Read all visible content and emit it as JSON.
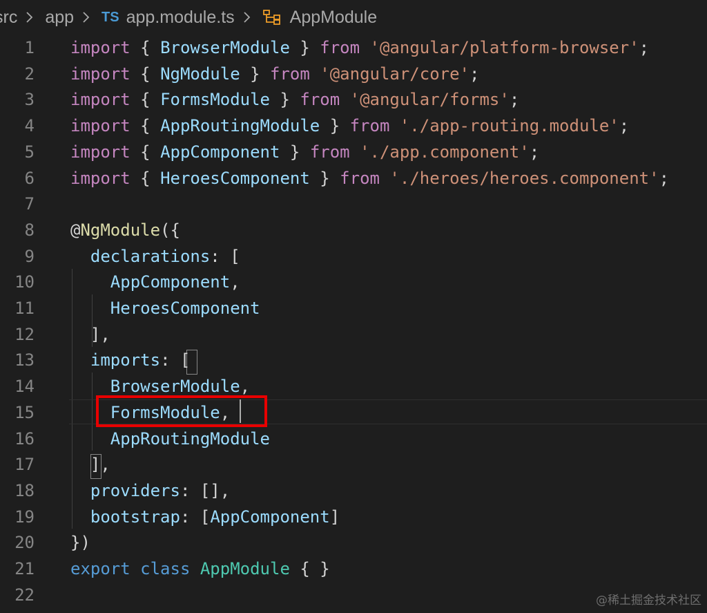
{
  "breadcrumb": {
    "segments": [
      "src",
      "app"
    ],
    "file_icon": "TS",
    "file_name": "app.module.ts",
    "symbol_icon": "symbol-class-icon",
    "symbol": "AppModule"
  },
  "line_numbers": [
    "1",
    "2",
    "3",
    "4",
    "5",
    "6",
    "7",
    "8",
    "9",
    "10",
    "11",
    "12",
    "13",
    "14",
    "15",
    "16",
    "17",
    "18",
    "19",
    "20",
    "21",
    "22"
  ],
  "code_lines": [
    [
      [
        "import",
        "kw"
      ],
      [
        " { ",
        "p"
      ],
      [
        "BrowserModule",
        "id"
      ],
      [
        " } ",
        "p"
      ],
      [
        "from",
        "kw"
      ],
      [
        " ",
        "p"
      ],
      [
        "'@angular/platform-browser'",
        "str"
      ],
      [
        ";",
        "p"
      ]
    ],
    [
      [
        "import",
        "kw"
      ],
      [
        " { ",
        "p"
      ],
      [
        "NgModule",
        "id"
      ],
      [
        " } ",
        "p"
      ],
      [
        "from",
        "kw"
      ],
      [
        " ",
        "p"
      ],
      [
        "'@angular/core'",
        "str"
      ],
      [
        ";",
        "p"
      ]
    ],
    [
      [
        "import",
        "kw"
      ],
      [
        " { ",
        "p"
      ],
      [
        "FormsModule",
        "id"
      ],
      [
        " } ",
        "p"
      ],
      [
        "from",
        "kw"
      ],
      [
        " ",
        "p"
      ],
      [
        "'@angular/forms'",
        "str"
      ],
      [
        ";",
        "p"
      ]
    ],
    [
      [
        "import",
        "kw"
      ],
      [
        " { ",
        "p"
      ],
      [
        "AppRoutingModule",
        "id"
      ],
      [
        " } ",
        "p"
      ],
      [
        "from",
        "kw"
      ],
      [
        " ",
        "p"
      ],
      [
        "'./app-routing.module'",
        "str"
      ],
      [
        ";",
        "p"
      ]
    ],
    [
      [
        "import",
        "kw"
      ],
      [
        " { ",
        "p"
      ],
      [
        "AppComponent",
        "id"
      ],
      [
        " } ",
        "p"
      ],
      [
        "from",
        "kw"
      ],
      [
        " ",
        "p"
      ],
      [
        "'./app.component'",
        "str"
      ],
      [
        ";",
        "p"
      ]
    ],
    [
      [
        "import",
        "kw"
      ],
      [
        " { ",
        "p"
      ],
      [
        "HeroesComponent",
        "id"
      ],
      [
        " } ",
        "p"
      ],
      [
        "from",
        "kw"
      ],
      [
        " ",
        "p"
      ],
      [
        "'./heroes/heroes.component'",
        "str"
      ],
      [
        ";",
        "p"
      ]
    ],
    [],
    [
      [
        "@",
        "p"
      ],
      [
        "NgModule",
        "fn"
      ],
      [
        "({",
        "p"
      ]
    ],
    [
      [
        "  ",
        "p"
      ],
      [
        "declarations",
        "id"
      ],
      [
        ": [",
        "p"
      ]
    ],
    [
      [
        "    ",
        "p"
      ],
      [
        "AppComponent",
        "id"
      ],
      [
        ",",
        "p"
      ]
    ],
    [
      [
        "    ",
        "p"
      ],
      [
        "HeroesComponent",
        "id"
      ]
    ],
    [
      [
        "  ],",
        "p"
      ]
    ],
    [
      [
        "  ",
        "p"
      ],
      [
        "imports",
        "id"
      ],
      [
        ": [",
        "p"
      ]
    ],
    [
      [
        "    ",
        "p"
      ],
      [
        "BrowserModule",
        "id"
      ],
      [
        ",",
        "p"
      ]
    ],
    [
      [
        "    ",
        "p"
      ],
      [
        "FormsModule",
        "id"
      ],
      [
        ",",
        "p"
      ]
    ],
    [
      [
        "    ",
        "p"
      ],
      [
        "AppRoutingModule",
        "id"
      ]
    ],
    [
      [
        "  ],",
        "p"
      ]
    ],
    [
      [
        "  ",
        "p"
      ],
      [
        "providers",
        "id"
      ],
      [
        ": [],",
        "p"
      ]
    ],
    [
      [
        "  ",
        "p"
      ],
      [
        "bootstrap",
        "id"
      ],
      [
        ": [",
        "p"
      ],
      [
        "AppComponent",
        "id"
      ],
      [
        "]",
        "p"
      ]
    ],
    [
      [
        "})",
        "p"
      ]
    ],
    [
      [
        "export",
        "kw2"
      ],
      [
        " ",
        "p"
      ],
      [
        "class",
        "kw2"
      ],
      [
        " ",
        "p"
      ],
      [
        "AppModule",
        "cls"
      ],
      [
        " { }",
        "p"
      ]
    ],
    []
  ],
  "colors": {
    "background": "#1e1e1e",
    "highlight_box": "#e80000",
    "keyword_control": "#c586c0",
    "keyword": "#569cd6",
    "identifier": "#9cdcfe",
    "string": "#ce9178",
    "function": "#dcdcaa",
    "class": "#4ec9b0"
  },
  "watermark": "@稀土掘金技术社区"
}
